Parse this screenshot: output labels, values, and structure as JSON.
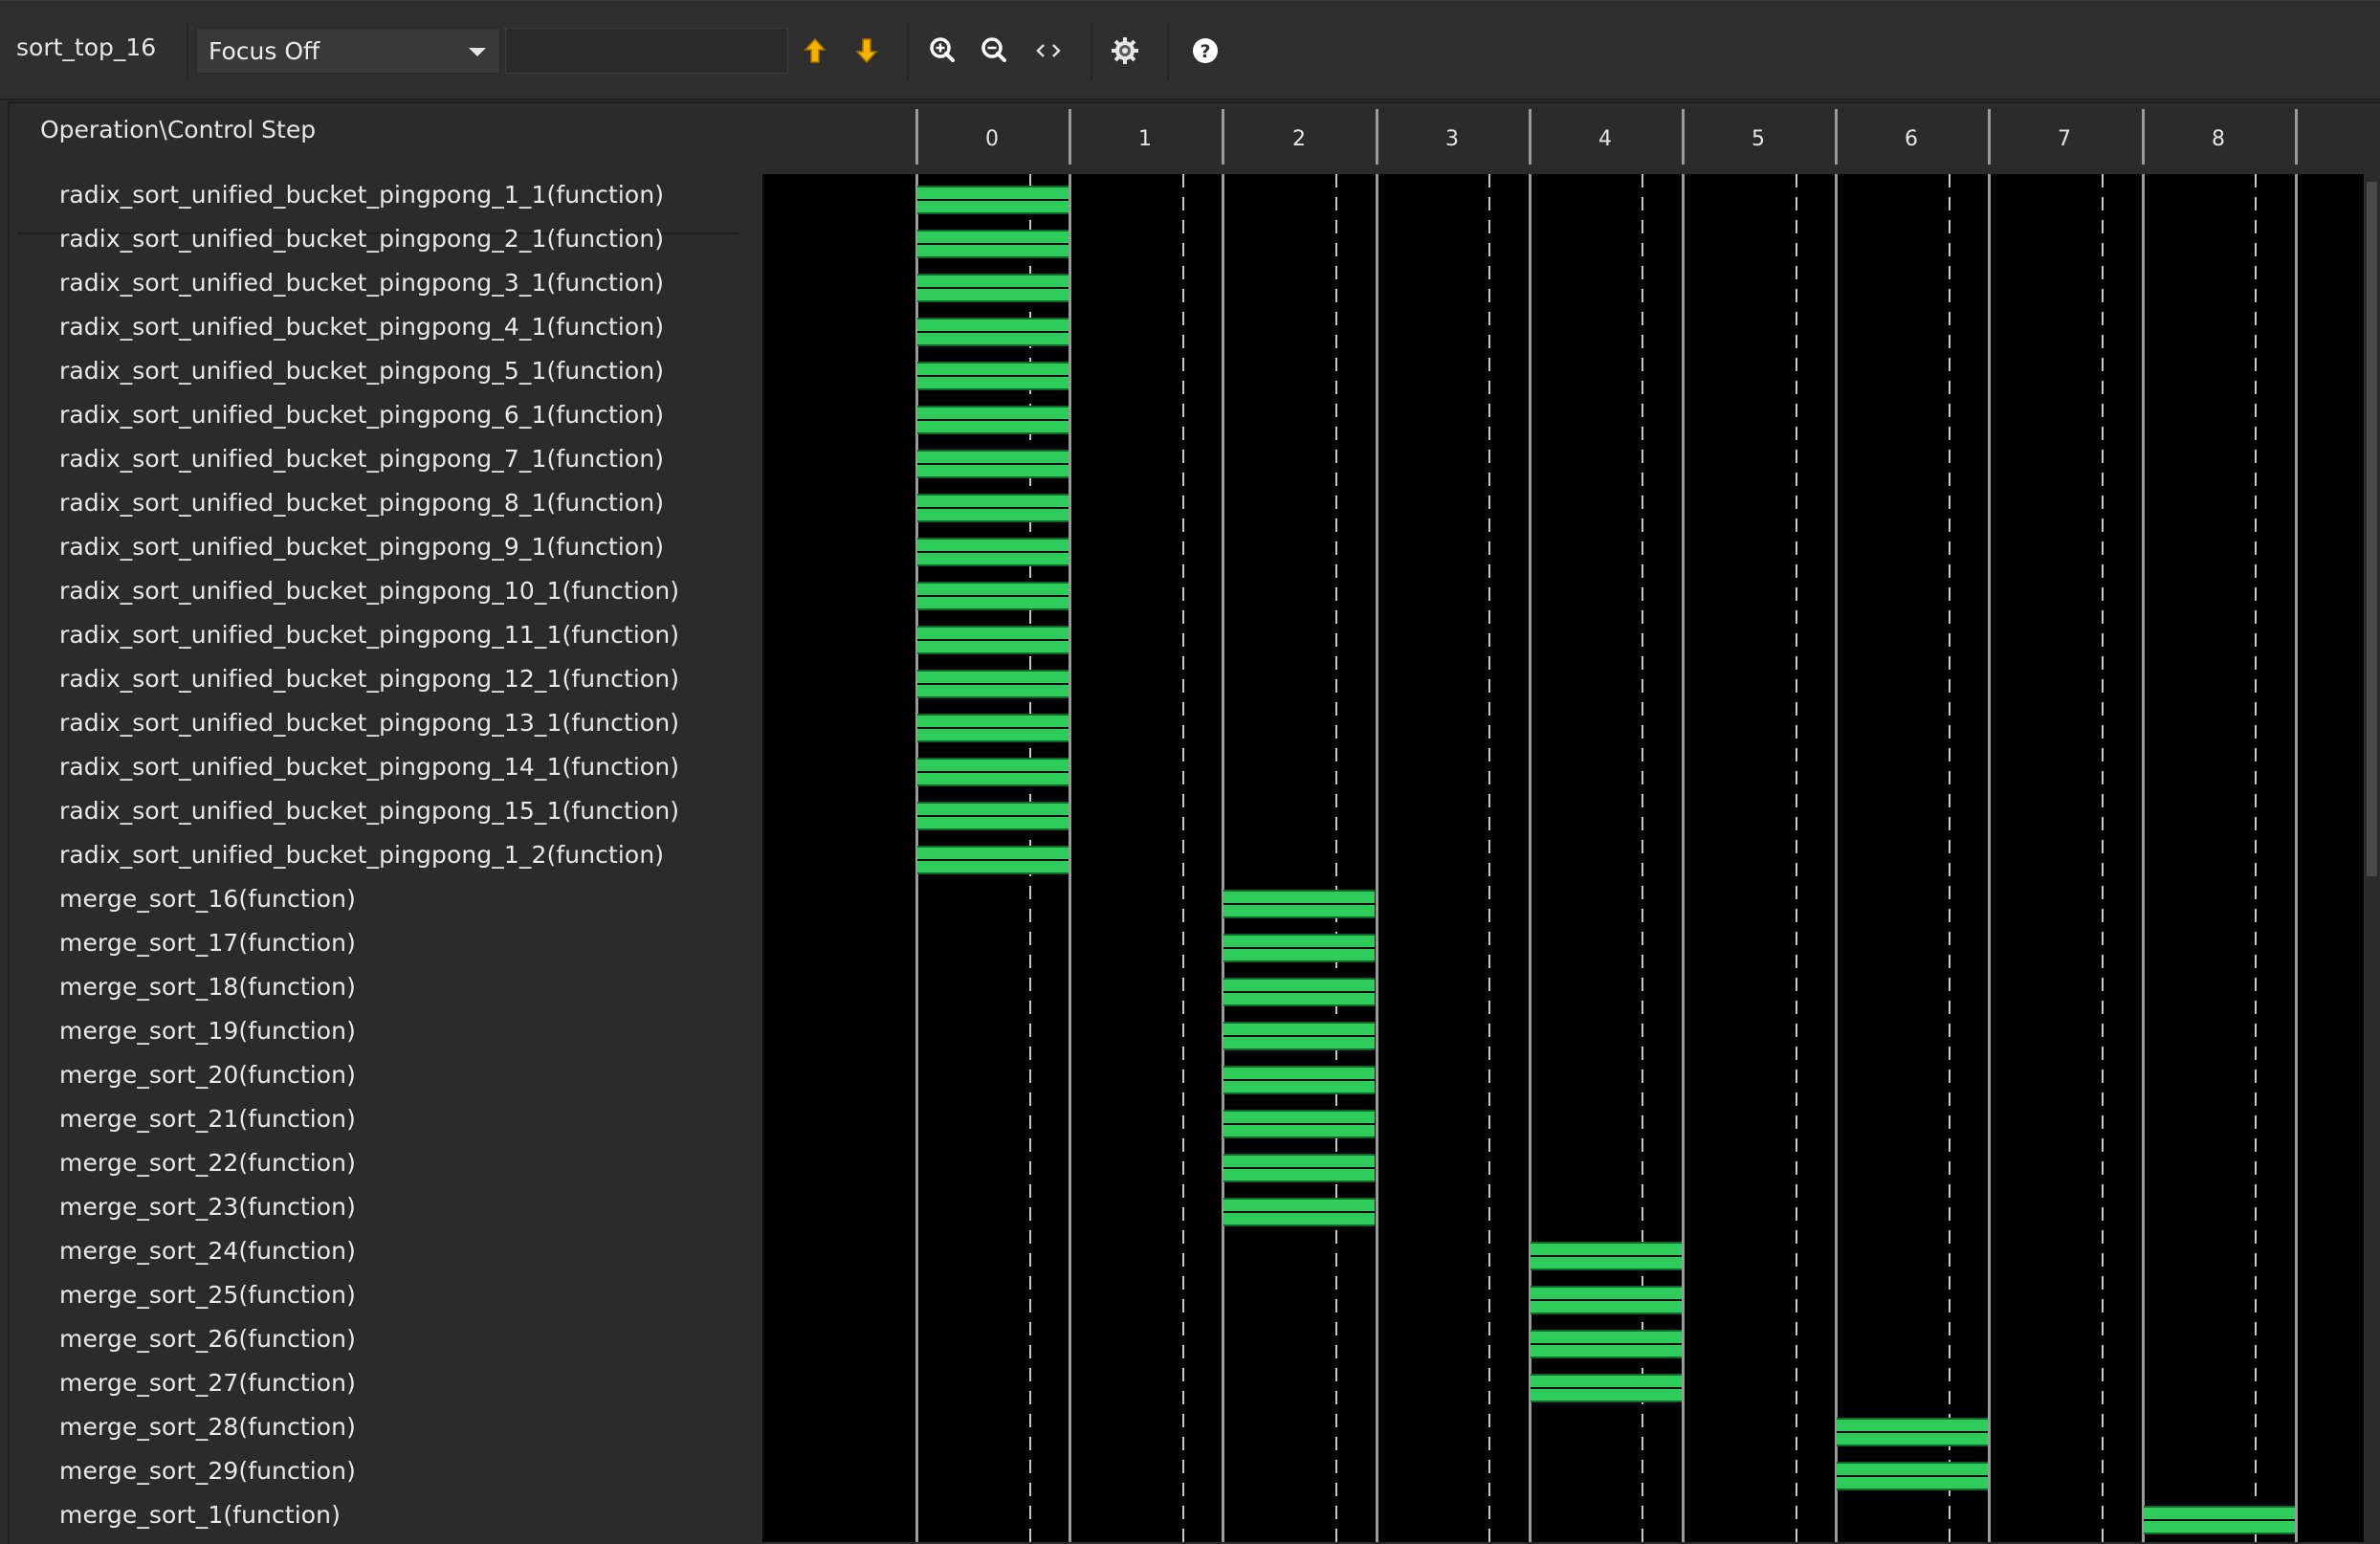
{
  "toolbar": {
    "module_name": "sort_top_16",
    "focus_select": {
      "selected": "Focus Off"
    },
    "search": {
      "value": "",
      "placeholder": ""
    },
    "buttons": [
      {
        "name": "up-arrow-icon",
        "tooltip": "Previous"
      },
      {
        "name": "down-arrow-icon",
        "tooltip": "Next"
      },
      {
        "name": "zoom-in-icon",
        "tooltip": "Zoom In"
      },
      {
        "name": "zoom-out-icon",
        "tooltip": "Zoom Out"
      },
      {
        "name": "zoom-fit-icon",
        "tooltip": "Zoom Fit"
      },
      {
        "name": "gear-icon",
        "tooltip": "Settings"
      },
      {
        "name": "help-icon",
        "tooltip": "Help"
      }
    ]
  },
  "schedule": {
    "column_header": "Operation\\Control Step",
    "control_steps": [
      "0",
      "1",
      "2",
      "3",
      "4",
      "5",
      "6",
      "7",
      "8"
    ],
    "operations": [
      {
        "label": "radix_sort_unified_bucket_pingpong_1_1(function)",
        "step": 0
      },
      {
        "label": "radix_sort_unified_bucket_pingpong_2_1(function)",
        "step": 0
      },
      {
        "label": "radix_sort_unified_bucket_pingpong_3_1(function)",
        "step": 0
      },
      {
        "label": "radix_sort_unified_bucket_pingpong_4_1(function)",
        "step": 0
      },
      {
        "label": "radix_sort_unified_bucket_pingpong_5_1(function)",
        "step": 0
      },
      {
        "label": "radix_sort_unified_bucket_pingpong_6_1(function)",
        "step": 0
      },
      {
        "label": "radix_sort_unified_bucket_pingpong_7_1(function)",
        "step": 0
      },
      {
        "label": "radix_sort_unified_bucket_pingpong_8_1(function)",
        "step": 0
      },
      {
        "label": "radix_sort_unified_bucket_pingpong_9_1(function)",
        "step": 0
      },
      {
        "label": "radix_sort_unified_bucket_pingpong_10_1(function)",
        "step": 0
      },
      {
        "label": "radix_sort_unified_bucket_pingpong_11_1(function)",
        "step": 0
      },
      {
        "label": "radix_sort_unified_bucket_pingpong_12_1(function)",
        "step": 0
      },
      {
        "label": "radix_sort_unified_bucket_pingpong_13_1(function)",
        "step": 0
      },
      {
        "label": "radix_sort_unified_bucket_pingpong_14_1(function)",
        "step": 0
      },
      {
        "label": "radix_sort_unified_bucket_pingpong_15_1(function)",
        "step": 0
      },
      {
        "label": "radix_sort_unified_bucket_pingpong_1_2(function)",
        "step": 0
      },
      {
        "label": "merge_sort_16(function)",
        "step": 2
      },
      {
        "label": "merge_sort_17(function)",
        "step": 2
      },
      {
        "label": "merge_sort_18(function)",
        "step": 2
      },
      {
        "label": "merge_sort_19(function)",
        "step": 2
      },
      {
        "label": "merge_sort_20(function)",
        "step": 2
      },
      {
        "label": "merge_sort_21(function)",
        "step": 2
      },
      {
        "label": "merge_sort_22(function)",
        "step": 2
      },
      {
        "label": "merge_sort_23(function)",
        "step": 2
      },
      {
        "label": "merge_sort_24(function)",
        "step": 4
      },
      {
        "label": "merge_sort_25(function)",
        "step": 4
      },
      {
        "label": "merge_sort_26(function)",
        "step": 4
      },
      {
        "label": "merge_sort_27(function)",
        "step": 4
      },
      {
        "label": "merge_sort_28(function)",
        "step": 6
      },
      {
        "label": "merge_sort_29(function)",
        "step": 6
      },
      {
        "label": "merge_sort_1(function)",
        "step": 8
      }
    ]
  },
  "colors": {
    "bar_fill": "#2ecc5b",
    "chart_background": "#000000",
    "panel_background": "#2b2b2b",
    "arrow_icon": "#f5b400"
  }
}
